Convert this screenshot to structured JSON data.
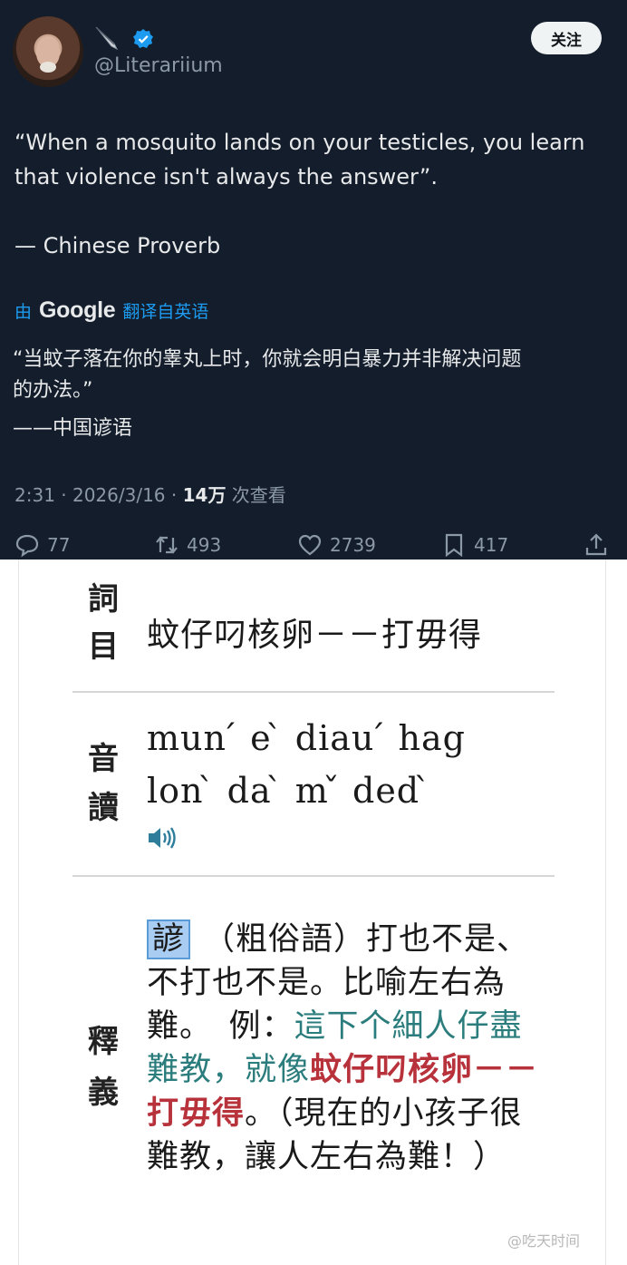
{
  "tweet": {
    "handle": "@Literariium",
    "follow_label": "关注",
    "quote_line1": "“When a mosquito lands on your testicles, you learn",
    "quote_line2": "that violence isn't always the answer”.",
    "attribution": "— Chinese Proverb",
    "translate_prefix": "由",
    "translate_brand": "Google",
    "translate_suffix": "翻译自英语",
    "translated_line1": "“当蚊子落在你的睾丸上时，你就会明白暴力并非解决问题",
    "translated_line2": "的办法。”",
    "translated_attribution": "——中国谚语",
    "time": "2:31 · 2026/3/16 · ",
    "views_count": "14万",
    "views_label": " 次查看",
    "replies": "77",
    "reposts": "493",
    "likes": "2739",
    "bookmarks": "417",
    "colors": {
      "background": "#141d2b",
      "text": "#e7e9ea",
      "muted": "#8b98a5",
      "accent": "#1d9bf0"
    },
    "icons": [
      "quill-icon",
      "verified-icon",
      "reply-icon",
      "repost-icon",
      "like-icon",
      "bookmark-icon",
      "share-icon"
    ]
  },
  "dictionary": {
    "label_entry_1": "詞",
    "label_entry_2": "目",
    "headword": "蚊仔叼核卵－－打毋得",
    "label_pron_1": "音",
    "label_pron_2": "讀",
    "pron_line1": "mun ́  e ̀  diau ́  hag",
    "pron_line2": "lon ̀  da ̀  m ̌  ded ̀",
    "label_def_1": "釋",
    "label_def_2": "義",
    "def_tag": "諺",
    "def_part1": "（粗俗語）打也不是、不打也不是。比喻左右為難。　例：",
    "def_example": "這下个細人仔盡難教，就像",
    "def_headword": "蚊仔叼核卵－－打毋得",
    "def_part2": "。（現在的小孩子很難教，讓人左右為難！）",
    "colors": {
      "example": "#2b7c7c",
      "highlight": "#b8323c",
      "tag_bg": "#a9cdf2"
    },
    "icons": [
      "speaker-icon"
    ]
  },
  "watermark": "@吃天时间"
}
